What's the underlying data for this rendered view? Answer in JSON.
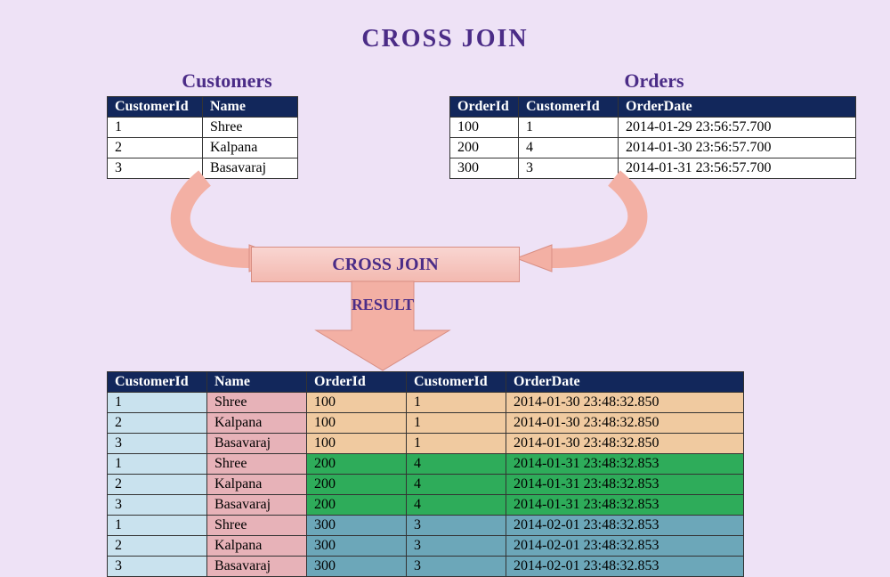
{
  "title": "CROSS JOIN",
  "customers": {
    "heading": "Customers",
    "columns": [
      "CustomerId",
      "Name"
    ],
    "rows": [
      {
        "CustomerId": "1",
        "Name": "Shree"
      },
      {
        "CustomerId": "2",
        "Name": "Kalpana"
      },
      {
        "CustomerId": "3",
        "Name": "Basavaraj"
      }
    ]
  },
  "orders": {
    "heading": "Orders",
    "columns": [
      "OrderId",
      "CustomerId",
      "OrderDate"
    ],
    "rows": [
      {
        "OrderId": "100",
        "CustomerId": "1",
        "OrderDate": "2014-01-29 23:56:57.700"
      },
      {
        "OrderId": "200",
        "CustomerId": "4",
        "OrderDate": "2014-01-30 23:56:57.700"
      },
      {
        "OrderId": "300",
        "CustomerId": "3",
        "OrderDate": "2014-01-31 23:56:57.700"
      }
    ]
  },
  "operator_label": "CROSS JOIN",
  "result_label": "RESULT",
  "result": {
    "columns": [
      "CustomerId",
      "Name",
      "OrderId",
      "CustomerId",
      "OrderDate"
    ],
    "rows": [
      {
        "group": 1,
        "CustomerId": "1",
        "Name": "Shree",
        "OrderId": "100",
        "CustomerId2": "1",
        "OrderDate": "2014-01-30 23:48:32.850"
      },
      {
        "group": 1,
        "CustomerId": "2",
        "Name": "Kalpana",
        "OrderId": "100",
        "CustomerId2": "1",
        "OrderDate": "2014-01-30 23:48:32.850"
      },
      {
        "group": 1,
        "CustomerId": "3",
        "Name": "Basavaraj",
        "OrderId": "100",
        "CustomerId2": "1",
        "OrderDate": "2014-01-30 23:48:32.850"
      },
      {
        "group": 2,
        "CustomerId": "1",
        "Name": "Shree",
        "OrderId": "200",
        "CustomerId2": "4",
        "OrderDate": "2014-01-31 23:48:32.853"
      },
      {
        "group": 2,
        "CustomerId": "2",
        "Name": "Kalpana",
        "OrderId": "200",
        "CustomerId2": "4",
        "OrderDate": "2014-01-31 23:48:32.853"
      },
      {
        "group": 2,
        "CustomerId": "3",
        "Name": "Basavaraj",
        "OrderId": "200",
        "CustomerId2": "4",
        "OrderDate": "2014-01-31 23:48:32.853"
      },
      {
        "group": 3,
        "CustomerId": "1",
        "Name": "Shree",
        "OrderId": "300",
        "CustomerId2": "3",
        "OrderDate": "2014-02-01 23:48:32.853"
      },
      {
        "group": 3,
        "CustomerId": "2",
        "Name": "Kalpana",
        "OrderId": "300",
        "CustomerId2": "3",
        "OrderDate": "2014-02-01 23:48:32.853"
      },
      {
        "group": 3,
        "CustomerId": "3",
        "Name": "Basavaraj",
        "OrderId": "300",
        "CustomerId2": "3",
        "OrderDate": "2014-02-01 23:48:32.853"
      }
    ]
  }
}
